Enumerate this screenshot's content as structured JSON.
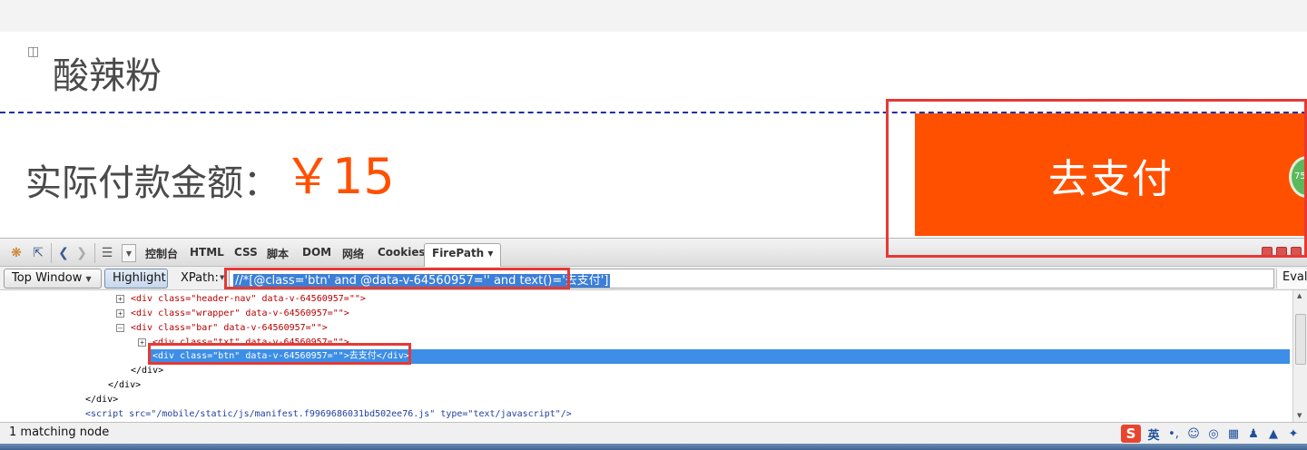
{
  "page": {
    "product_icon": "bag-icon",
    "product_name": "酸辣粉",
    "pay_label": "实际付款金额：",
    "amount": "￥15",
    "pay_button": "去支付",
    "float_badge": "75",
    "accent_color": "#ff5000"
  },
  "devtools": {
    "tabs": [
      "控制台",
      "HTML",
      "CSS",
      "脚本",
      "DOM",
      "网络",
      "Cookies",
      "FirePath ▾"
    ],
    "active_tab": "FirePath ▾"
  },
  "xpath_bar": {
    "window_select": "Top Window",
    "highlight_button": "Highlight",
    "xpath_label": "XPath:",
    "xpath_value": "//*[@class='btn' and @data-v-64560957='' and text()='去支付']",
    "eval_button": "Eval"
  },
  "tree": [
    {
      "text": "<div class=\"header-nav\" data-v-64560957=\"\">"
    },
    {
      "text": "<div class=\"wrapper\" data-v-64560957=\"\">"
    },
    {
      "text": "<div class=\"bar\" data-v-64560957=\"\">"
    },
    {
      "text": "<div class=\"txt\" data-v-64560957=\"\">"
    },
    {
      "text": "<div class=\"btn\" data-v-64560957=\"\">去支付</div>"
    },
    {
      "text": "</div>"
    },
    {
      "text": "</div>"
    },
    {
      "text": "</div>"
    },
    {
      "text": "<script src=\"/mobile/static/js/manifest.f9969686031bd502ee76.js\" type=\"text/javascript\"/>"
    }
  ],
  "status_bar": {
    "text": "1 matching node",
    "ime_label": "英"
  },
  "colors": {
    "highlight_border": "#e53935",
    "selection": "#3d8ee6"
  }
}
